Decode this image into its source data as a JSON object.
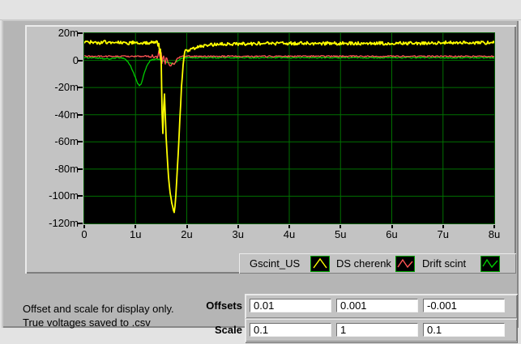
{
  "graph": {
    "colors": {
      "plot_bg": "#000000",
      "grid": "#007000",
      "plot_border": "#005a00",
      "tick": "#000000",
      "panel": "#c3c3c3"
    }
  },
  "legend": {
    "items": [
      {
        "label": "Gscint_US",
        "color": "#ffff00"
      },
      {
        "label": "DS cherenk",
        "color": "#ff5454"
      },
      {
        "label": "Drift scint",
        "color": "#00cc00"
      }
    ]
  },
  "note": {
    "line1": "Offset and scale for display only.",
    "line2": "True voltages saved to .csv"
  },
  "controls": {
    "offsets_label": "Offsets",
    "scale_label": "Scale",
    "offsets": [
      "0.01",
      "0.001",
      "-0.001"
    ],
    "scale": [
      "0.1",
      "1",
      "0.1"
    ]
  },
  "chart_data": {
    "type": "line",
    "title": "",
    "xlabel": "",
    "ylabel": "",
    "x_unit": "us",
    "y_unit": "m (display volts)",
    "xlim": [
      0,
      8
    ],
    "ylim": [
      -120,
      20
    ],
    "grid": true,
    "legend_position": "bottom-right",
    "x_tick_labels": [
      "0",
      "1u",
      "2u",
      "3u",
      "4u",
      "5u",
      "6u",
      "7u",
      "8u"
    ],
    "y_tick_labels": [
      "20m",
      "0",
      "-20m",
      "-40m",
      "-60m",
      "-80m",
      "-100m",
      "-120m"
    ],
    "x_tick_values": [
      0,
      1,
      2,
      3,
      4,
      5,
      6,
      7,
      8
    ],
    "y_tick_values": [
      20,
      0,
      -20,
      -40,
      -60,
      -80,
      -100,
      -120
    ],
    "series": [
      {
        "name": "Gscint_US",
        "color": "#ffff00",
        "width": 1.8,
        "noise": 1.2,
        "points": [
          [
            0,
            13
          ],
          [
            0.1,
            13.5
          ],
          [
            0.25,
            12.5
          ],
          [
            0.4,
            13.5
          ],
          [
            0.55,
            13
          ],
          [
            0.7,
            13.5
          ],
          [
            0.85,
            12.5
          ],
          [
            1.0,
            13.5
          ],
          [
            1.1,
            13
          ],
          [
            1.2,
            12.5
          ],
          [
            1.3,
            13
          ],
          [
            1.38,
            12.5
          ],
          [
            1.42,
            13.5
          ],
          [
            1.44,
            10
          ],
          [
            1.46,
            13
          ],
          [
            1.47,
            6
          ],
          [
            1.48,
            11
          ],
          [
            1.5,
            2
          ],
          [
            1.51,
            -20
          ],
          [
            1.52,
            -45
          ],
          [
            1.53,
            -57
          ],
          [
            1.545,
            -40
          ],
          [
            1.555,
            -28
          ],
          [
            1.565,
            -25
          ],
          [
            1.575,
            -32
          ],
          [
            1.585,
            -45
          ],
          [
            1.6,
            -58
          ],
          [
            1.62,
            -72
          ],
          [
            1.65,
            -88
          ],
          [
            1.68,
            -98
          ],
          [
            1.71,
            -106
          ],
          [
            1.74,
            -111
          ],
          [
            1.755,
            -113
          ],
          [
            1.77,
            -107
          ],
          [
            1.79,
            -97
          ],
          [
            1.81,
            -85
          ],
          [
            1.83,
            -70
          ],
          [
            1.85,
            -55
          ],
          [
            1.87,
            -40
          ],
          [
            1.89,
            -25
          ],
          [
            1.91,
            -12
          ],
          [
            1.93,
            -3
          ],
          [
            1.95,
            3
          ],
          [
            1.97,
            7
          ],
          [
            2.0,
            8
          ],
          [
            2.05,
            7
          ],
          [
            2.1,
            8.5
          ],
          [
            2.2,
            9.5
          ],
          [
            2.3,
            10.5
          ],
          [
            2.4,
            11
          ],
          [
            2.5,
            11.5
          ],
          [
            2.7,
            12
          ],
          [
            3.0,
            12
          ],
          [
            3.5,
            12.5
          ],
          [
            4.0,
            12.5
          ],
          [
            4.5,
            12.5
          ],
          [
            5.0,
            12.5
          ],
          [
            5.5,
            12.5
          ],
          [
            6.0,
            12.5
          ],
          [
            6.5,
            12.5
          ],
          [
            7.0,
            13
          ],
          [
            7.5,
            13
          ],
          [
            8.0,
            13
          ]
        ]
      },
      {
        "name": "DS cherenk",
        "color": "#ff5454",
        "width": 1.3,
        "noise": 0.5,
        "points": [
          [
            0,
            3
          ],
          [
            0.5,
            3
          ],
          [
            1.0,
            3
          ],
          [
            1.25,
            3
          ],
          [
            1.3,
            2
          ],
          [
            1.33,
            4
          ],
          [
            1.36,
            1.5
          ],
          [
            1.4,
            3.5
          ],
          [
            1.43,
            1
          ],
          [
            1.46,
            8
          ],
          [
            1.48,
            -1
          ],
          [
            1.5,
            6.5
          ],
          [
            1.52,
            -3
          ],
          [
            1.54,
            5
          ],
          [
            1.56,
            1
          ],
          [
            1.58,
            -3.5
          ],
          [
            1.6,
            3
          ],
          [
            1.63,
            -1
          ],
          [
            1.66,
            -3
          ],
          [
            1.69,
            -4.5
          ],
          [
            1.72,
            -1.5
          ],
          [
            1.75,
            -3.5
          ],
          [
            1.78,
            -1
          ],
          [
            1.81,
            1
          ],
          [
            1.84,
            2
          ],
          [
            1.88,
            2.5
          ],
          [
            1.92,
            3
          ],
          [
            2.0,
            3
          ],
          [
            2.5,
            3
          ],
          [
            3.0,
            3
          ],
          [
            4.0,
            3
          ],
          [
            5.0,
            3
          ],
          [
            6.0,
            3
          ],
          [
            7.0,
            3
          ],
          [
            8.0,
            3
          ]
        ]
      },
      {
        "name": "Drift scint",
        "color": "#00cc00",
        "width": 1.3,
        "noise": 0.45,
        "points": [
          [
            0,
            2
          ],
          [
            0.2,
            2
          ],
          [
            0.35,
            1.2
          ],
          [
            0.5,
            1
          ],
          [
            0.6,
            1.8
          ],
          [
            0.7,
            2
          ],
          [
            0.78,
            1.5
          ],
          [
            0.85,
            -1
          ],
          [
            0.9,
            -4
          ],
          [
            0.95,
            -8
          ],
          [
            1.0,
            -13
          ],
          [
            1.04,
            -17
          ],
          [
            1.08,
            -19
          ],
          [
            1.12,
            -16.5
          ],
          [
            1.16,
            -11
          ],
          [
            1.2,
            -6
          ],
          [
            1.24,
            -2.5
          ],
          [
            1.28,
            -0.5
          ],
          [
            1.33,
            0.5
          ],
          [
            1.4,
            1
          ],
          [
            1.48,
            0.5
          ],
          [
            1.55,
            -0.5
          ],
          [
            1.62,
            -1.5
          ],
          [
            1.68,
            -2
          ],
          [
            1.74,
            -2.5
          ],
          [
            1.8,
            -1
          ],
          [
            1.85,
            0.5
          ],
          [
            1.9,
            1.5
          ],
          [
            1.95,
            2
          ],
          [
            2.1,
            2
          ],
          [
            3.0,
            2
          ],
          [
            4.0,
            2
          ],
          [
            5.0,
            2
          ],
          [
            6.0,
            2
          ],
          [
            7.0,
            2
          ],
          [
            8.0,
            2
          ]
        ]
      }
    ]
  }
}
